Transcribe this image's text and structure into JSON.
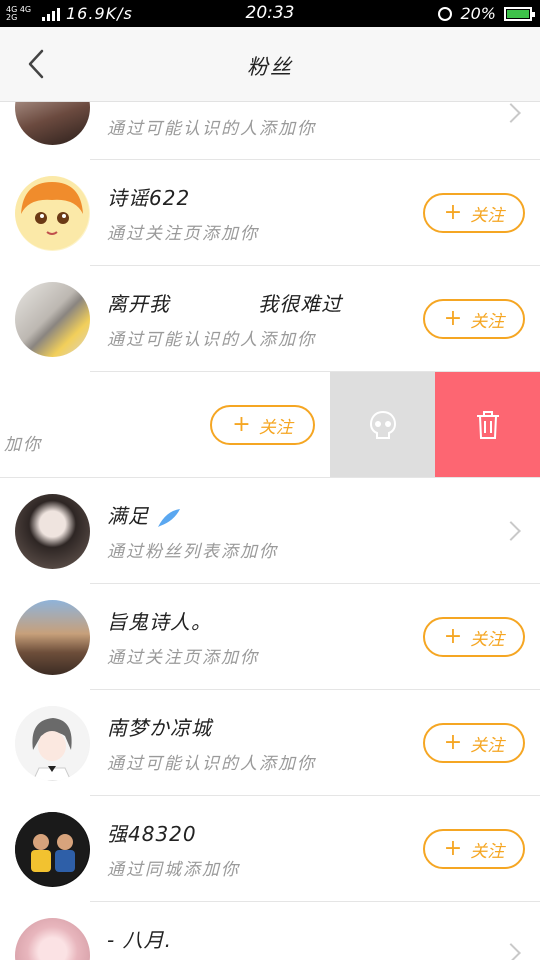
{
  "status_bar": {
    "network": "4G 4G 2G",
    "speed": "16.9K/s",
    "time": "20:33",
    "battery": "20%",
    "icons": [
      "signal-icon",
      "alarm-icon",
      "battery-charging-icon"
    ]
  },
  "header": {
    "title": "粉丝",
    "back_icon": "chevron-left-icon"
  },
  "follow_label": "关注",
  "rows": [
    {
      "name": "",
      "source": "通过可能认识的人添加你",
      "action": "chevron"
    },
    {
      "name": "诗谣622",
      "source": "通过关注页添加你",
      "action": "follow"
    },
    {
      "name": "离开我            我很难过",
      "source": "通过可能认识的人添加你",
      "action": "follow"
    },
    {
      "name": "",
      "source": "加你",
      "action": "swiped"
    },
    {
      "name": "满足",
      "source": "通过粉丝列表添加你",
      "action": "chevron"
    },
    {
      "name": "旨鬼诗人。",
      "source": "通过关注页添加你",
      "action": "follow"
    },
    {
      "name": "南梦か凉城",
      "source": "通过可能认识的人添加你",
      "action": "follow"
    },
    {
      "name": "强48320",
      "source": "通过同城添加你",
      "action": "follow"
    },
    {
      "name": "- 八月.",
      "source": "",
      "action": "chevron"
    }
  ],
  "colors": {
    "accent": "#f5a623",
    "delete": "#fd6672",
    "ignore": "#dedede",
    "header_bg": "#f7f7f7"
  }
}
